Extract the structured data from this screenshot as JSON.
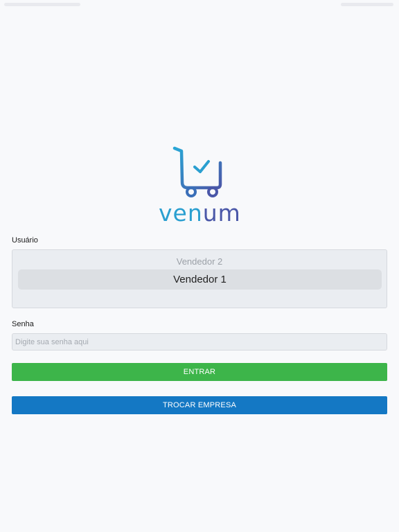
{
  "app": {
    "logo_text_prefix": "ven",
    "logo_text_accent": "um",
    "brand_colors": {
      "cyan": "#2a9fd0",
      "indigo": "#4a57a8"
    }
  },
  "form": {
    "user_label": "Usuário",
    "user_picker": {
      "options": [
        "Vendedor 2",
        "Vendedor 1"
      ],
      "selected": "Vendedor 1"
    },
    "password_label": "Senha",
    "password_placeholder": "Digite sua senha aqui",
    "password_value": ""
  },
  "buttons": {
    "enter_label": "ENTRAR",
    "enter_color": "#3db54a",
    "switch_company_label": "TROCAR EMPRESA",
    "switch_company_color": "#1478c4"
  },
  "icons": [
    "cart-check-icon"
  ]
}
